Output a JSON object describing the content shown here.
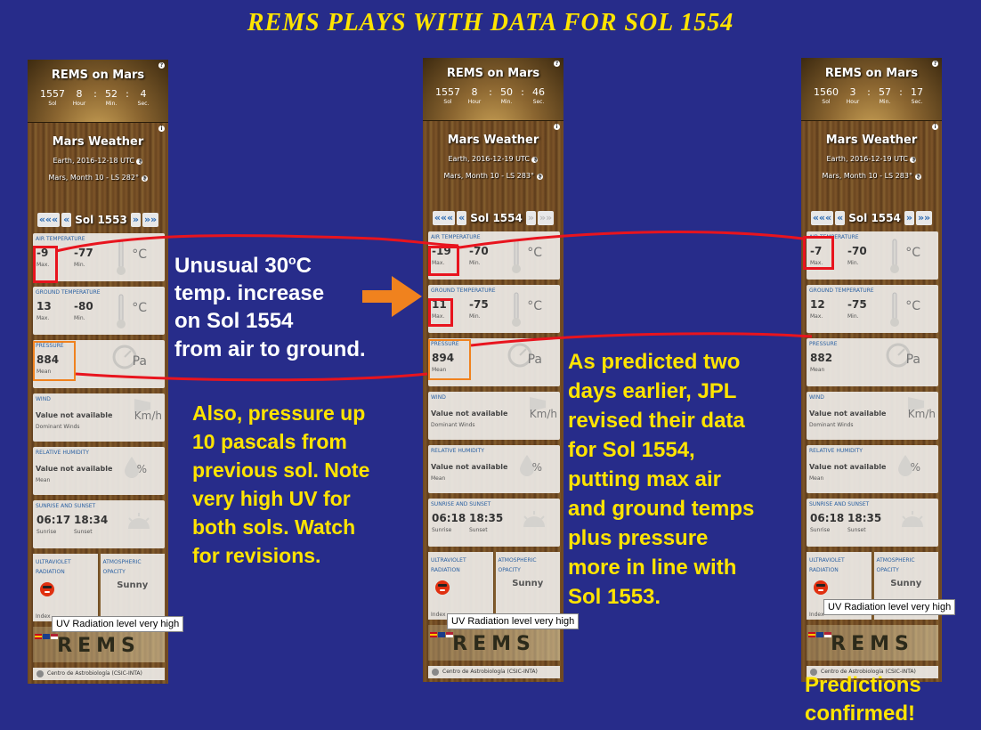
{
  "title": "REMS PLAYS WITH DATA FOR SOL 1554",
  "widget_common": {
    "app_title": "REMS on Mars",
    "section_title": "Mars Weather",
    "clock_labels": {
      "sol": "Sol",
      "hour": "Hour",
      "min": "Min.",
      "sec": "Sec."
    },
    "nav": {
      "first": "«««",
      "prev": "«",
      "next": "»",
      "last": "»»"
    },
    "labels": {
      "air": "AIR TEMPERATURE",
      "ground": "GROUND TEMPERATURE",
      "pressure": "PRESSURE",
      "wind": "WIND",
      "humidity": "RELATIVE HUMIDITY",
      "sun": "SUNRISE AND SUNSET",
      "uv_1": "ULTRAVIOLET",
      "uv_2": "RADIATION",
      "opacity_1": "ATMOSPHERIC",
      "opacity_2": "OPACITY",
      "max": "Max.",
      "min": "Min.",
      "mean": "Mean",
      "sunrise": "Sunrise",
      "sunset": "Sunset",
      "dominant": "Dominant Winds",
      "index": "Index",
      "na": "Value not available",
      "celsius": "°C",
      "pa": "Pa",
      "kmh": "Km/h",
      "pct": "%"
    },
    "opacity": "Sunny",
    "rems_logo": "REMS",
    "footer": "Centro de Astrobiología (CSIC-INTA)",
    "tooltip": "UV Radiation level very high"
  },
  "widgets": [
    {
      "clock": {
        "sol": "1557",
        "hour": "8",
        "min": "52",
        "sec": "4"
      },
      "earth": "Earth, 2016-12-18 UTC",
      "mars": "Mars, Month 10 - LS 282°",
      "sol_label": "Sol 1553",
      "air": {
        "max": "-9",
        "min": "-77"
      },
      "ground": {
        "max": "13",
        "min": "-80"
      },
      "pressure": "884",
      "sunrise": "06:17",
      "sunset": "18:34"
    },
    {
      "clock": {
        "sol": "1557",
        "hour": "8",
        "min": "50",
        "sec": "46"
      },
      "earth": "Earth, 2016-12-19 UTC",
      "mars": "Mars, Month 10 - LS 283°",
      "sol_label": "Sol 1554",
      "air": {
        "max": "-19",
        "min": "-70"
      },
      "ground": {
        "max": "11",
        "min": "-75"
      },
      "pressure": "894",
      "sunrise": "06:18",
      "sunset": "18:35"
    },
    {
      "clock": {
        "sol": "1560",
        "hour": "3",
        "min": "57",
        "sec": "17"
      },
      "earth": "Earth, 2016-12-19 UTC",
      "mars": "Mars, Month 10 - LS 283°",
      "sol_label": "Sol 1554",
      "air": {
        "max": "-7",
        "min": "-70"
      },
      "ground": {
        "max": "12",
        "min": "-75"
      },
      "pressure": "882",
      "sunrise": "06:18",
      "sunset": "18:35"
    }
  ],
  "annotations": {
    "unusual_1": "Unusual 30",
    "unusual_deg": "o",
    "unusual_c": "C",
    "unusual_2": "temp. increase",
    "unusual_3": "on Sol 1554",
    "unusual_4": "from air to ground.",
    "also_1": "Also, pressure up",
    "also_2": "10 pascals from",
    "also_3": "previous sol. Note",
    "also_4": "very high UV for",
    "also_5": "both sols. Watch",
    "also_6": "for revisions.",
    "pred_1": "As predicted two",
    "pred_2": "days earlier, JPL",
    "pred_3": "revised their data",
    "pred_4": "for Sol 1554,",
    "pred_5": "putting max air",
    "pred_6": "and ground temps",
    "pred_7": "plus pressure",
    "pred_8": "more in line with",
    "pred_9": "Sol 1553.",
    "confirm_1": "Predictions",
    "confirm_2": "confirmed!"
  },
  "colors": {
    "background": "#272c8a",
    "title": "#ffe400",
    "annotation_white": "#ffffff",
    "annotation_yellow": "#ffe400",
    "highlight_red": "#e8141e",
    "arrow_orange": "#f0821e"
  }
}
